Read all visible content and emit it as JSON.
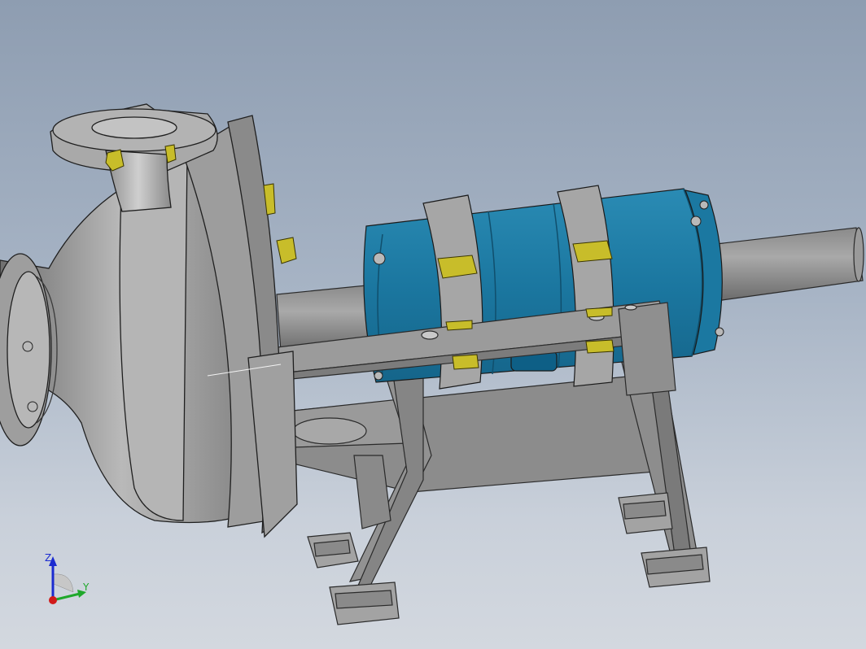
{
  "viewport": {
    "background_top": "#8e9db1",
    "background_bottom": "#d3d8df"
  },
  "model": {
    "casing_color": "#9b9b9b",
    "bearing_housing_color": "#1e7fa6",
    "fastener_color": "#c8bd2a",
    "frame_color": "#8f8f8f"
  },
  "triad": {
    "z_label": "Z",
    "y_label": "Y",
    "x_color": "#d11a1a",
    "y_color": "#1fa82b",
    "z_color": "#1b2bd0"
  }
}
